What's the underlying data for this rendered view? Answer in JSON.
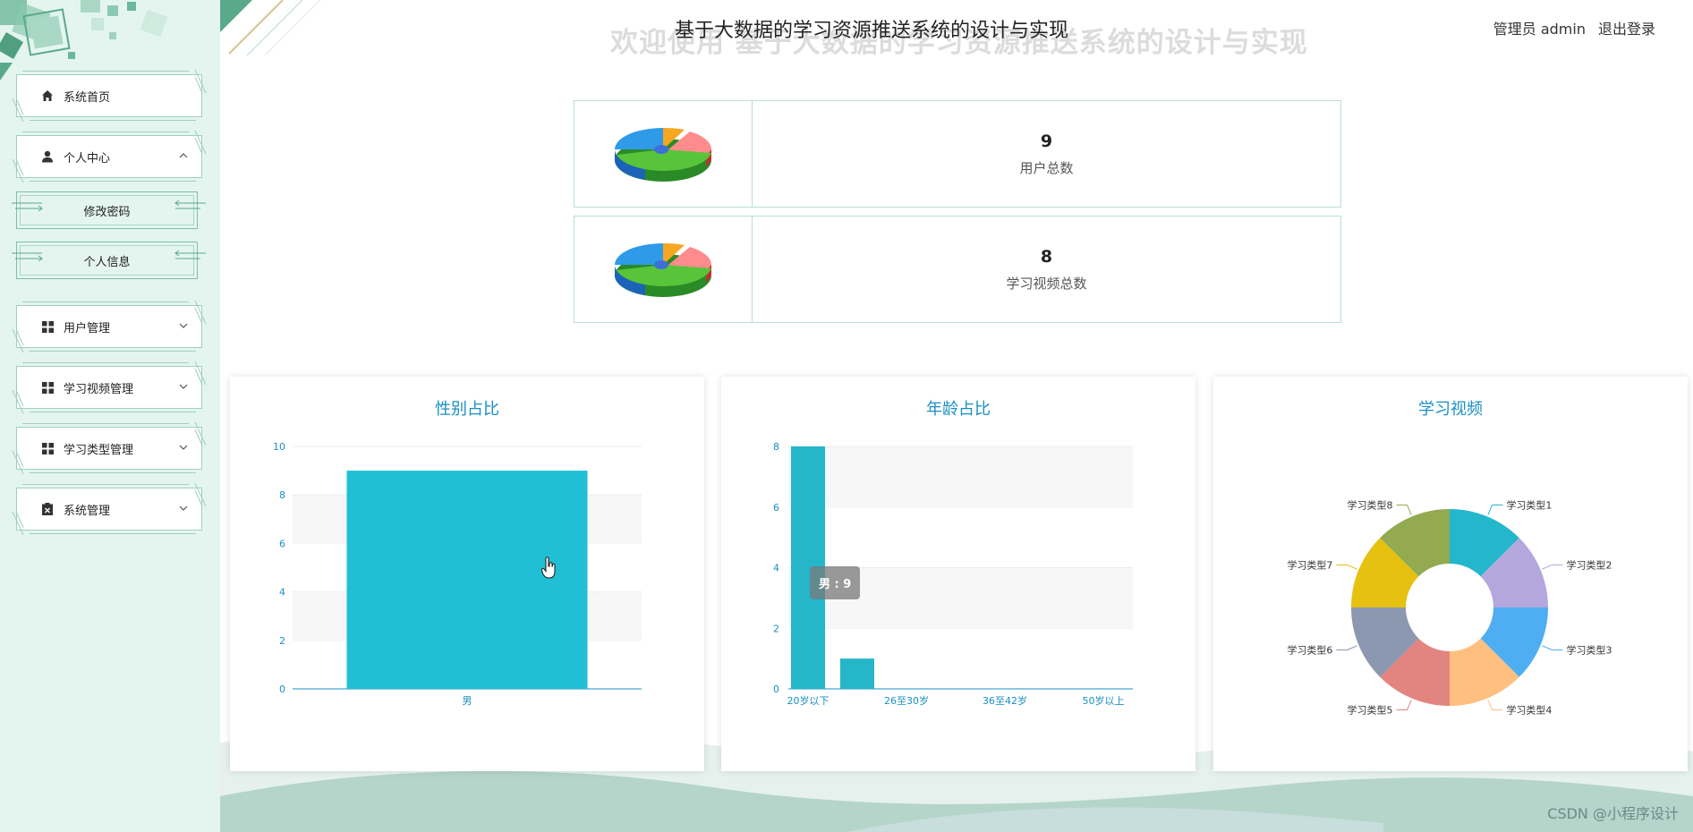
{
  "header": {
    "system_title": "基于大数据的学习资源推送系统的设计与实现",
    "watermark_title": "欢迎使用 基于大数据的学习资源推送系统的设计与实现",
    "user_label": "管理员 admin",
    "logout_label": "退出登录"
  },
  "sidebar": {
    "items": [
      {
        "label": "系统首页",
        "icon": "home-icon"
      },
      {
        "label": "个人中心",
        "icon": "user-icon",
        "expanded": true,
        "children": [
          {
            "label": "修改密码"
          },
          {
            "label": "个人信息"
          }
        ]
      },
      {
        "label": "用户管理",
        "icon": "grid-icon"
      },
      {
        "label": "学习视频管理",
        "icon": "grid-icon"
      },
      {
        "label": "学习类型管理",
        "icon": "grid-icon"
      },
      {
        "label": "系统管理",
        "icon": "clipboard-icon"
      }
    ]
  },
  "stats": [
    {
      "value": "9",
      "label": "用户总数"
    },
    {
      "value": "8",
      "label": "学习视频总数"
    }
  ],
  "tooltip": "男 : 9",
  "footer_watermark": "CSDN @小程序设计",
  "colors": {
    "sidebar_bg": "#e4f4ef",
    "accent": "#1a8fc4",
    "bar": "#21bfd6",
    "bar2": "#25b6c9"
  },
  "chart_data": [
    {
      "type": "bar",
      "title": "性别占比",
      "categories": [
        "男"
      ],
      "values": [
        9
      ],
      "ylim": [
        0,
        10
      ],
      "yticks": [
        0,
        2,
        4,
        6,
        8,
        10
      ]
    },
    {
      "type": "bar",
      "title": "年龄占比",
      "categories": [
        "20岁以下",
        "",
        "26至30岁",
        "",
        "36至42岁",
        "",
        "50岁以上"
      ],
      "values": [
        8,
        1,
        0,
        0,
        0,
        0,
        0
      ],
      "ylim": [
        0,
        8
      ],
      "yticks": [
        0,
        2,
        4,
        6,
        8
      ]
    },
    {
      "type": "pie",
      "title": "学习视频",
      "donut": true,
      "categories": [
        "学习类型1",
        "学习类型2",
        "学习类型3",
        "学习类型4",
        "学习类型5",
        "学习类型6",
        "学习类型7",
        "学习类型8"
      ],
      "values": [
        1,
        1,
        1,
        1,
        1,
        1,
        1,
        1
      ],
      "colors": [
        "#24b6cb",
        "#b4a7de",
        "#4eaef1",
        "#ffbf7f",
        "#e2847f",
        "#8c98b0",
        "#e6c10f",
        "#94aa51"
      ]
    }
  ]
}
